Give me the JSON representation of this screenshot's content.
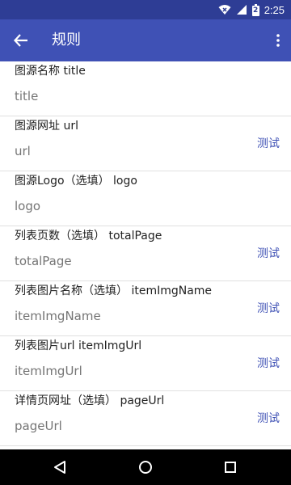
{
  "status_bar": {
    "time": "2:25",
    "battery": "2"
  },
  "app_bar": {
    "title": "规则"
  },
  "rows": [
    {
      "label": "图源名称 title",
      "value": "title",
      "test": ""
    },
    {
      "label": "图源网址 url",
      "value": "url",
      "test": "测试"
    },
    {
      "label": "图源Logo（选填） logo",
      "value": "logo",
      "test": ""
    },
    {
      "label": "列表页数（选填） totalPage",
      "value": "totalPage",
      "test": "测试"
    },
    {
      "label": "列表图片名称（选填） itemImgName",
      "value": "itemImgName",
      "test": "测试"
    },
    {
      "label": "列表图片url itemImgUrl",
      "value": "itemImgUrl",
      "test": "测试"
    },
    {
      "label": "详情页网址（选填） pageUrl",
      "value": "pageUrl",
      "test": "测试"
    }
  ],
  "colors": {
    "primary": "#3f51b5",
    "primary_dark": "#2e3d95",
    "accent_text": "#3f51b5"
  },
  "icons": [
    "back-arrow-icon",
    "more-vert-icon",
    "wifi-icon",
    "signal-icon",
    "battery-icon",
    "nav-back-icon",
    "nav-home-icon",
    "nav-recents-icon"
  ]
}
